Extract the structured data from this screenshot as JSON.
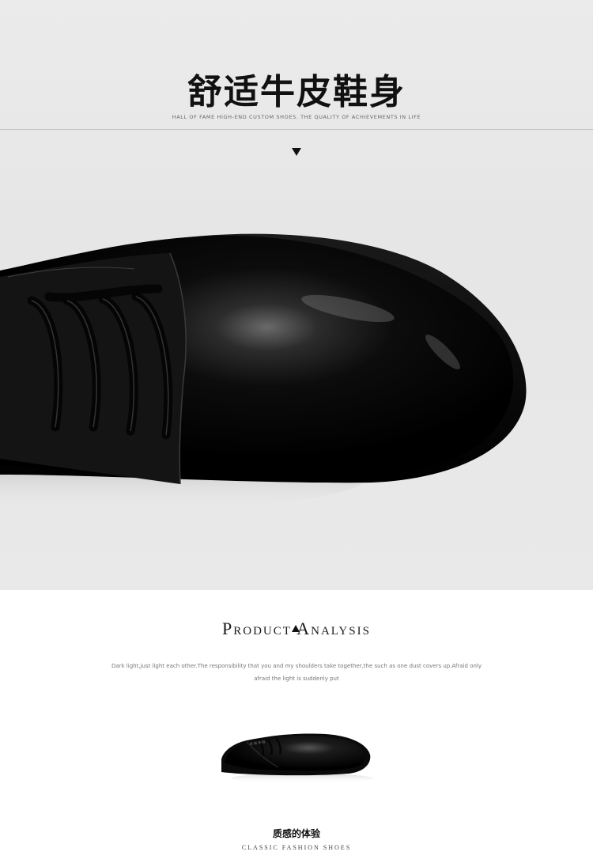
{
  "hero": {
    "title": "舒适牛皮鞋身",
    "subtitle": "HALL OF FAME HIGH-END CUSTOM SHOES. THE QUALITY OF ACHIEVEMENTS IN LIFE",
    "image_name": "black-leather-shoe-closeup"
  },
  "analysis": {
    "title": "Product Analysis",
    "text_line1": "Dark light,just light each other.The responsibility that you and my shoulders take together,the such as one dust covers up.Afraid only",
    "text_line2": "afraid the light is suddenly put"
  },
  "product": {
    "image_name": "black-leather-shoe"
  },
  "caption": {
    "cn": "质感的体验",
    "en": "CLASSIC FASHION SHOES"
  },
  "colors": {
    "hero_bg": "#e8e8e8",
    "shoe": "#0a0a0a",
    "text": "#111111"
  }
}
